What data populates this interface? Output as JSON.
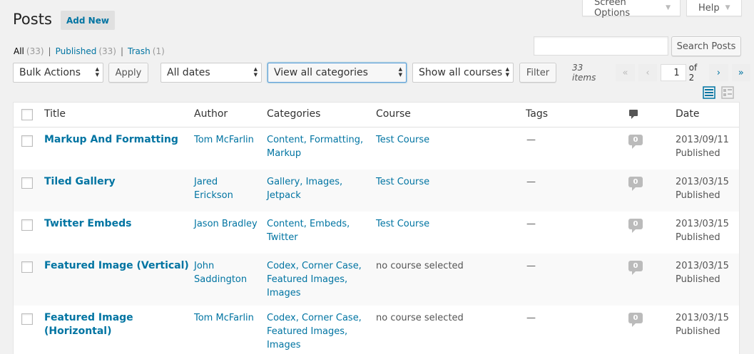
{
  "screen_meta": {
    "screen_options": "Screen Options",
    "help": "Help"
  },
  "header": {
    "title": "Posts",
    "add_new": "Add New"
  },
  "views": [
    {
      "label": "All",
      "count": "(33)"
    },
    {
      "label": "Published",
      "count": "(33)"
    },
    {
      "label": "Trash",
      "count": "(1)"
    }
  ],
  "search": {
    "button": "Search Posts",
    "value": ""
  },
  "filters": {
    "bulk_actions": "Bulk Actions",
    "apply": "Apply",
    "dates": "All dates",
    "categories": "View all categories",
    "courses": "Show all courses",
    "filter": "Filter"
  },
  "pagination": {
    "items": "33 items",
    "first": "«",
    "prev": "‹",
    "current": "1",
    "of": "of 2",
    "next": "›",
    "last": "»"
  },
  "columns": {
    "title": "Title",
    "author": "Author",
    "categories": "Categories",
    "course": "Course",
    "tags": "Tags",
    "date": "Date"
  },
  "posts": [
    {
      "title": [
        "Markup And Formatting"
      ],
      "author": [
        "Tom McFarlin"
      ],
      "categories": [
        "Content, Formatting,",
        "Markup"
      ],
      "course": "Test Course",
      "course_linked": true,
      "tags": "—",
      "comments": "0",
      "date": "2013/09/11",
      "status": "Published"
    },
    {
      "title": [
        "Tiled Gallery"
      ],
      "author": [
        "Jared",
        "Erickson"
      ],
      "categories": [
        "Gallery, Images,",
        "Jetpack"
      ],
      "course": "Test Course",
      "course_linked": true,
      "tags": "—",
      "comments": "0",
      "date": "2013/03/15",
      "status": "Published"
    },
    {
      "title": [
        "Twitter Embeds"
      ],
      "author": [
        "Jason Bradley"
      ],
      "categories": [
        "Content, Embeds,",
        "Twitter"
      ],
      "course": "Test Course",
      "course_linked": true,
      "tags": "—",
      "comments": "0",
      "date": "2013/03/15",
      "status": "Published"
    },
    {
      "title": [
        "Featured Image (Vertical)"
      ],
      "author": [
        "John",
        "Saddington"
      ],
      "categories": [
        "Codex, Corner Case,",
        "Featured Images,",
        "Images"
      ],
      "course": "no course selected",
      "course_linked": false,
      "tags": "—",
      "comments": "0",
      "date": "2013/03/15",
      "status": "Published"
    },
    {
      "title": [
        "Featured Image",
        "(Horizontal)"
      ],
      "author": [
        "Tom McFarlin"
      ],
      "categories": [
        "Codex, Corner Case,",
        "Featured Images,",
        "Images"
      ],
      "course": "no course selected",
      "course_linked": false,
      "tags": "—",
      "comments": "0",
      "date": "2013/03/15",
      "status": "Published"
    }
  ],
  "colors": {
    "link": "#0074a2",
    "background": "#f1f1f1",
    "alt_row": "#f9f9f9",
    "bubble": "#bbbbbb"
  }
}
